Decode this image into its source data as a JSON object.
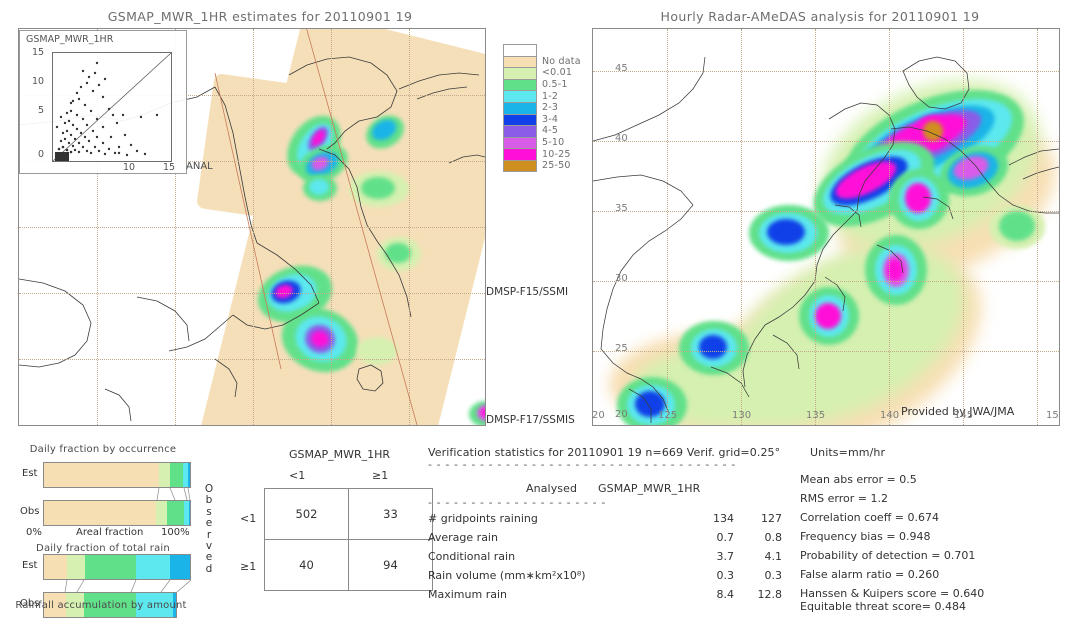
{
  "left_panel": {
    "title": "GSMAP_MWR_1HR estimates for 20110901 19",
    "inset_label": "GSMAP_MWR_1HR",
    "inset_axis_label": "ANAL",
    "inset_ticks_y": [
      "15",
      "10",
      "5",
      "0"
    ],
    "inset_ticks_x": [
      "10",
      "15"
    ],
    "satellite_labels": [
      "DMSP-F15/SSMI",
      "DMSP-F17/SSMIS"
    ]
  },
  "right_panel": {
    "title": "Hourly Radar-AMeDAS analysis for 20110901 19",
    "credit": "Provided by JWA/JMA",
    "lon_ticks": [
      "20",
      "125",
      "130",
      "135",
      "140",
      "145",
      "15"
    ],
    "lat_ticks": [
      "45",
      "40",
      "35",
      "30",
      "25"
    ],
    "corner_lat": "20"
  },
  "colorbar": {
    "entries": [
      {
        "label": "",
        "color": "#ffffff"
      },
      {
        "label": "No data",
        "color": "#f7dfb4"
      },
      {
        "label": "<0.01",
        "color": "#d5f0b0"
      },
      {
        "label": "0.5-1",
        "color": "#61e08a"
      },
      {
        "label": "1-2",
        "color": "#5ce8ee"
      },
      {
        "label": "2-3",
        "color": "#1ab4e8"
      },
      {
        "label": "3-4",
        "color": "#1040e8"
      },
      {
        "label": "4-5",
        "color": "#8b5ce8"
      },
      {
        "label": "5-10",
        "color": "#d95ce8"
      },
      {
        "label": "10-25",
        "color": "#ff10d8"
      },
      {
        "label": "25-50",
        "color": "#cf8f1e"
      }
    ]
  },
  "bar_charts": [
    {
      "title": "Daily fraction by occurrence",
      "axis_label": "Areal fraction",
      "axis_min": "0%",
      "axis_max": "100%",
      "rows": [
        {
          "label": "Est",
          "segments": [
            {
              "color": "#f7dfb4",
              "pct": 78.5
            },
            {
              "color": "#d5f0b0",
              "pct": 7.5
            },
            {
              "color": "#61e08a",
              "pct": 9.5
            },
            {
              "color": "#5ce8ee",
              "pct": 3.0
            },
            {
              "color": "#1ab4e8",
              "pct": 1.5
            }
          ]
        },
        {
          "label": "Obs",
          "segments": [
            {
              "color": "#f7dfb4",
              "pct": 77.0
            },
            {
              "color": "#d5f0b0",
              "pct": 7.0
            },
            {
              "color": "#61e08a",
              "pct": 12.0
            },
            {
              "color": "#5ce8ee",
              "pct": 3.0
            },
            {
              "color": "#1ab4e8",
              "pct": 1.0
            }
          ]
        }
      ]
    },
    {
      "title": "Daily fraction of total rain",
      "axis_label": "Rainfall accumulation by amount",
      "rows": [
        {
          "label": "Est",
          "width_pct": 100,
          "segments": [
            {
              "color": "#f7dfb4",
              "pct": 16.0
            },
            {
              "color": "#d5f0b0",
              "pct": 12.0
            },
            {
              "color": "#61e08a",
              "pct": 35.0
            },
            {
              "color": "#5ce8ee",
              "pct": 23.0
            },
            {
              "color": "#1ab4e8",
              "pct": 14.0
            }
          ]
        },
        {
          "label": "Obs",
          "width_pct": 90,
          "segments": [
            {
              "color": "#f7dfb4",
              "pct": 17.0
            },
            {
              "color": "#d5f0b0",
              "pct": 13.0
            },
            {
              "color": "#61e08a",
              "pct": 40.0
            },
            {
              "color": "#5ce8ee",
              "pct": 28.0
            },
            {
              "color": "#1ab4e8",
              "pct": 2.0
            }
          ]
        }
      ]
    }
  ],
  "contingency": {
    "title": "GSMAP_MWR_1HR",
    "col_headers": [
      "<1",
      "≥1"
    ],
    "row_headers": [
      "<1",
      "≥1"
    ],
    "axis_label": "Observed",
    "cells": [
      [
        "502",
        "33"
      ],
      [
        "40",
        "94"
      ]
    ]
  },
  "verification": {
    "header": "Verification statistics for 20110901 19   n=669  Verif. grid=0.25°",
    "divider": "- - - - - - - - - - - - - - - - - - - - - - - - - - - - - - - - - - - -",
    "col_headers": [
      "Analysed",
      "GSMAP_MWR_1HR"
    ],
    "divider2": "- - - - - - - - - - - - - - - - - - - - -",
    "rows": [
      {
        "label": "# gridpoints raining",
        "analysed": "134",
        "estimate": "127"
      },
      {
        "label": "Average rain",
        "analysed": "0.7",
        "estimate": "0.8"
      },
      {
        "label": "Conditional rain",
        "analysed": "3.7",
        "estimate": "4.1"
      },
      {
        "label": "Rain volume (mm∗km²x10⁸)",
        "analysed": "0.3",
        "estimate": "0.3"
      },
      {
        "label": "Maximum rain",
        "analysed": "8.4",
        "estimate": "12.8"
      }
    ],
    "scores": [
      {
        "label": "Mean abs error = 0.5"
      },
      {
        "label": "RMS error = 1.2"
      },
      {
        "label": "Correlation coeff = 0.674"
      },
      {
        "label": "Frequency bias = 0.948"
      },
      {
        "label": "Probability of detection = 0.701"
      },
      {
        "label": "False alarm ratio = 0.260"
      },
      {
        "label": "Hanssen & Kuipers score = 0.640"
      },
      {
        "label": "Equitable threat score= 0.484"
      }
    ]
  },
  "units": "Units=mm/hr"
}
